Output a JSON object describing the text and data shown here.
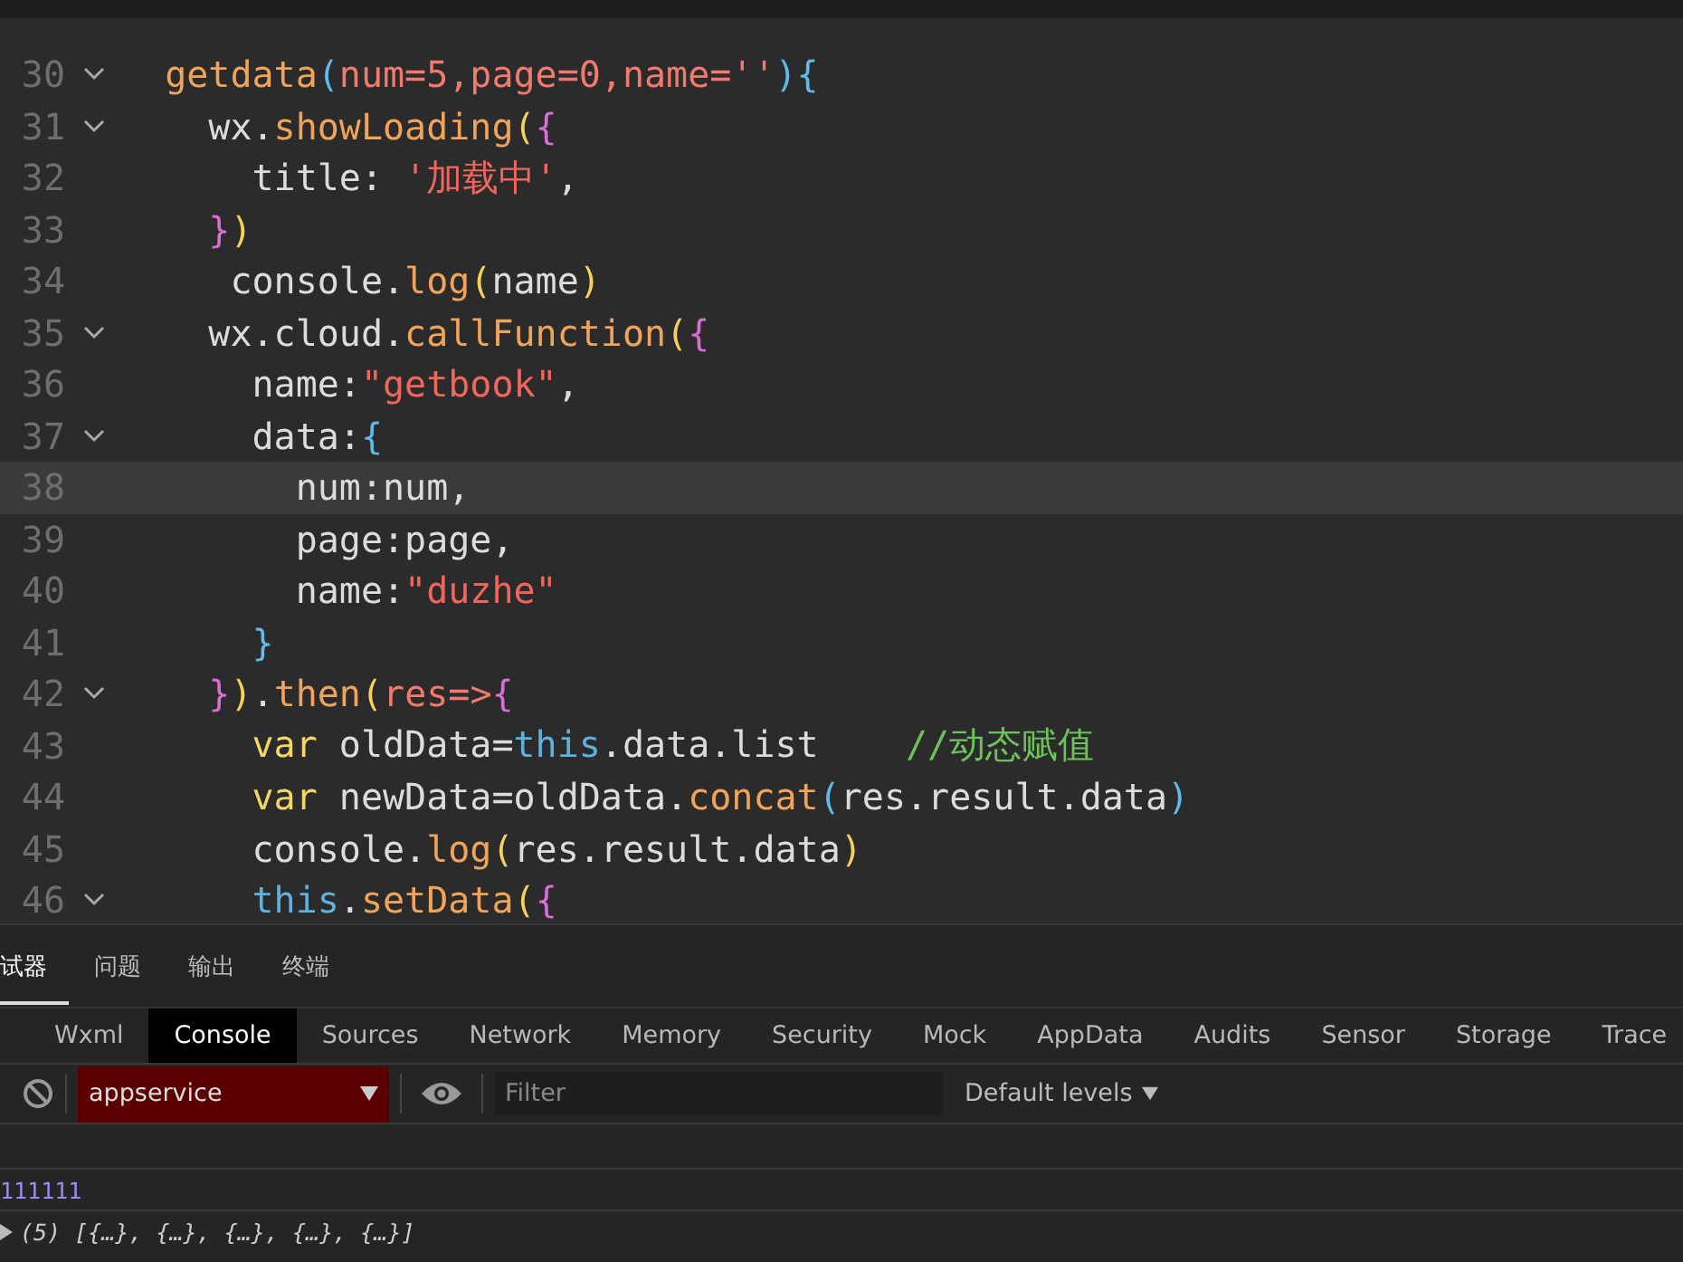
{
  "editor": {
    "lines": [
      {
        "number": "30",
        "fold": true,
        "highlighted": false,
        "tokens": [
          {
            "kind": "fn",
            "text": "  getdata"
          },
          {
            "kind": "b3",
            "text": "("
          },
          {
            "kind": "param",
            "text": "num=5,page=0,name=''"
          },
          {
            "kind": "b3",
            "text": "){"
          }
        ]
      },
      {
        "number": "31",
        "fold": true,
        "highlighted": false,
        "tokens": [
          {
            "kind": "plain",
            "text": "    wx."
          },
          {
            "kind": "fn",
            "text": "showLoading"
          },
          {
            "kind": "b1",
            "text": "("
          },
          {
            "kind": "b2",
            "text": "{"
          }
        ]
      },
      {
        "number": "32",
        "fold": false,
        "highlighted": false,
        "tokens": [
          {
            "kind": "plain",
            "text": "      title: "
          },
          {
            "kind": "str",
            "text": "'加载中'"
          },
          {
            "kind": "plain",
            "text": ","
          }
        ]
      },
      {
        "number": "33",
        "fold": false,
        "highlighted": false,
        "tokens": [
          {
            "kind": "b2",
            "text": "    }"
          },
          {
            "kind": "b1",
            "text": ")"
          }
        ]
      },
      {
        "number": "34",
        "fold": false,
        "highlighted": false,
        "tokens": [
          {
            "kind": "plain",
            "text": "     console."
          },
          {
            "kind": "fn",
            "text": "log"
          },
          {
            "kind": "b1",
            "text": "("
          },
          {
            "kind": "plain",
            "text": "name"
          },
          {
            "kind": "b1",
            "text": ")"
          }
        ]
      },
      {
        "number": "35",
        "fold": true,
        "highlighted": false,
        "tokens": [
          {
            "kind": "plain",
            "text": "    wx.cloud."
          },
          {
            "kind": "fn",
            "text": "callFunction"
          },
          {
            "kind": "b1",
            "text": "("
          },
          {
            "kind": "b2",
            "text": "{"
          }
        ]
      },
      {
        "number": "36",
        "fold": false,
        "highlighted": false,
        "tokens": [
          {
            "kind": "plain",
            "text": "      name:"
          },
          {
            "kind": "str",
            "text": "\"getbook\""
          },
          {
            "kind": "plain",
            "text": ","
          }
        ]
      },
      {
        "number": "37",
        "fold": true,
        "highlighted": false,
        "tokens": [
          {
            "kind": "plain",
            "text": "      data:"
          },
          {
            "kind": "b3",
            "text": "{"
          }
        ]
      },
      {
        "number": "38",
        "fold": false,
        "highlighted": true,
        "tokens": [
          {
            "kind": "plain",
            "text": "        num:num,"
          }
        ]
      },
      {
        "number": "39",
        "fold": false,
        "highlighted": false,
        "tokens": [
          {
            "kind": "plain",
            "text": "        page:page,"
          }
        ]
      },
      {
        "number": "40",
        "fold": false,
        "highlighted": false,
        "tokens": [
          {
            "kind": "plain",
            "text": "        name:"
          },
          {
            "kind": "str",
            "text": "\"duzhe\""
          }
        ]
      },
      {
        "number": "41",
        "fold": false,
        "highlighted": false,
        "tokens": [
          {
            "kind": "b3",
            "text": "      }"
          }
        ]
      },
      {
        "number": "42",
        "fold": true,
        "highlighted": false,
        "tokens": [
          {
            "kind": "b2",
            "text": "    }"
          },
          {
            "kind": "b1",
            "text": ")"
          },
          {
            "kind": "plain",
            "text": "."
          },
          {
            "kind": "fn",
            "text": "then"
          },
          {
            "kind": "b1",
            "text": "("
          },
          {
            "kind": "param",
            "text": "res=>"
          },
          {
            "kind": "b2",
            "text": "{"
          }
        ]
      },
      {
        "number": "43",
        "fold": false,
        "highlighted": false,
        "tokens": [
          {
            "kind": "kw",
            "text": "      var"
          },
          {
            "kind": "plain",
            "text": " oldData="
          },
          {
            "kind": "this",
            "text": "this"
          },
          {
            "kind": "plain",
            "text": ".data.list    "
          },
          {
            "kind": "comment",
            "text": "//动态赋值"
          }
        ]
      },
      {
        "number": "44",
        "fold": false,
        "highlighted": false,
        "tokens": [
          {
            "kind": "kw",
            "text": "      var"
          },
          {
            "kind": "plain",
            "text": " newData=oldData."
          },
          {
            "kind": "fn",
            "text": "concat"
          },
          {
            "kind": "b3",
            "text": "("
          },
          {
            "kind": "plain",
            "text": "res.result.data"
          },
          {
            "kind": "b3",
            "text": ")"
          }
        ]
      },
      {
        "number": "45",
        "fold": false,
        "highlighted": false,
        "tokens": [
          {
            "kind": "plain",
            "text": "      console."
          },
          {
            "kind": "fn",
            "text": "log"
          },
          {
            "kind": "b1",
            "text": "("
          },
          {
            "kind": "plain",
            "text": "res.result.data"
          },
          {
            "kind": "b1",
            "text": ")"
          }
        ]
      },
      {
        "number": "46",
        "fold": true,
        "highlighted": false,
        "tokens": [
          {
            "kind": "this",
            "text": "      this"
          },
          {
            "kind": "plain",
            "text": "."
          },
          {
            "kind": "fn",
            "text": "setData"
          },
          {
            "kind": "b1",
            "text": "("
          },
          {
            "kind": "b2",
            "text": "{"
          }
        ]
      }
    ]
  },
  "panel_tabs": [
    {
      "label": "试器",
      "selected": true
    },
    {
      "label": "问题",
      "selected": false
    },
    {
      "label": "输出",
      "selected": false
    },
    {
      "label": "终端",
      "selected": false
    }
  ],
  "devtools_tabs": [
    {
      "label": "Wxml",
      "selected": false
    },
    {
      "label": "Console",
      "selected": true
    },
    {
      "label": "Sources",
      "selected": false
    },
    {
      "label": "Network",
      "selected": false
    },
    {
      "label": "Memory",
      "selected": false
    },
    {
      "label": "Security",
      "selected": false
    },
    {
      "label": "Mock",
      "selected": false
    },
    {
      "label": "AppData",
      "selected": false
    },
    {
      "label": "Audits",
      "selected": false
    },
    {
      "label": "Sensor",
      "selected": false
    },
    {
      "label": "Storage",
      "selected": false
    },
    {
      "label": "Trace",
      "selected": false
    }
  ],
  "console_toolbar": {
    "context": "appservice",
    "filter": {
      "placeholder": "Filter"
    },
    "levels": "Default levels"
  },
  "console_output": [
    {
      "kind": "text",
      "text": "111111"
    },
    {
      "kind": "array",
      "text": "(5) [{…}, {…}, {…}, {…}, {…}]"
    }
  ]
}
